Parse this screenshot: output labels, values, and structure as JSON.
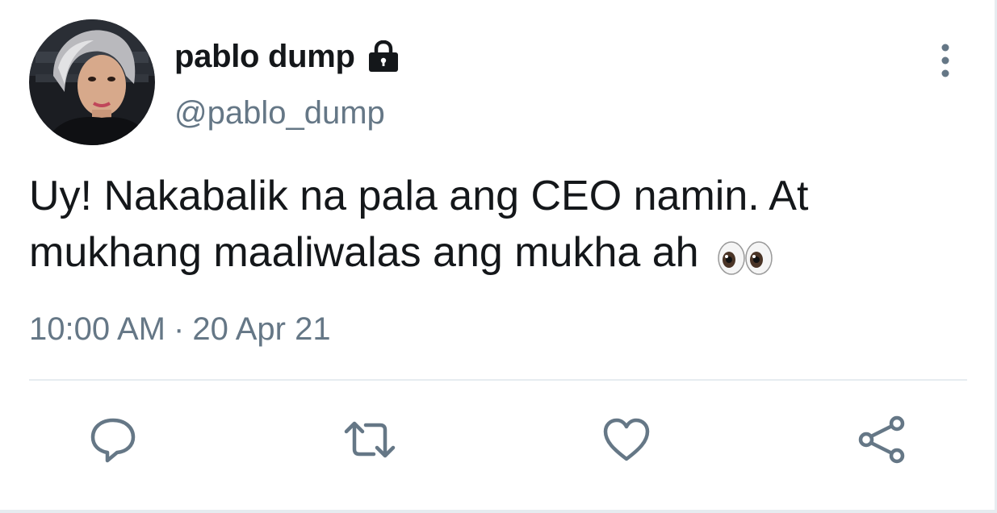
{
  "tweet": {
    "author": {
      "display_name": "pablo dump",
      "handle": "@pablo_dump",
      "protected": true
    },
    "text_line1": "Uy! Nakabalik na pala ang CEO namin. At",
    "text_line2": "mukhang maaliwalas ang mukha ah",
    "emoji": "eyes-emoji",
    "time": "10:00 AM",
    "separator": "·",
    "date": "20 Apr 21"
  },
  "icons": {
    "lock": "lock-icon",
    "more": "more-vertical-icon",
    "reply": "reply-icon",
    "retweet": "retweet-icon",
    "like": "heart-icon",
    "share": "share-icon"
  },
  "colors": {
    "text_primary": "#14171a",
    "text_secondary": "#657786",
    "icon_gray": "#657786",
    "divider": "#e6ecf0"
  }
}
